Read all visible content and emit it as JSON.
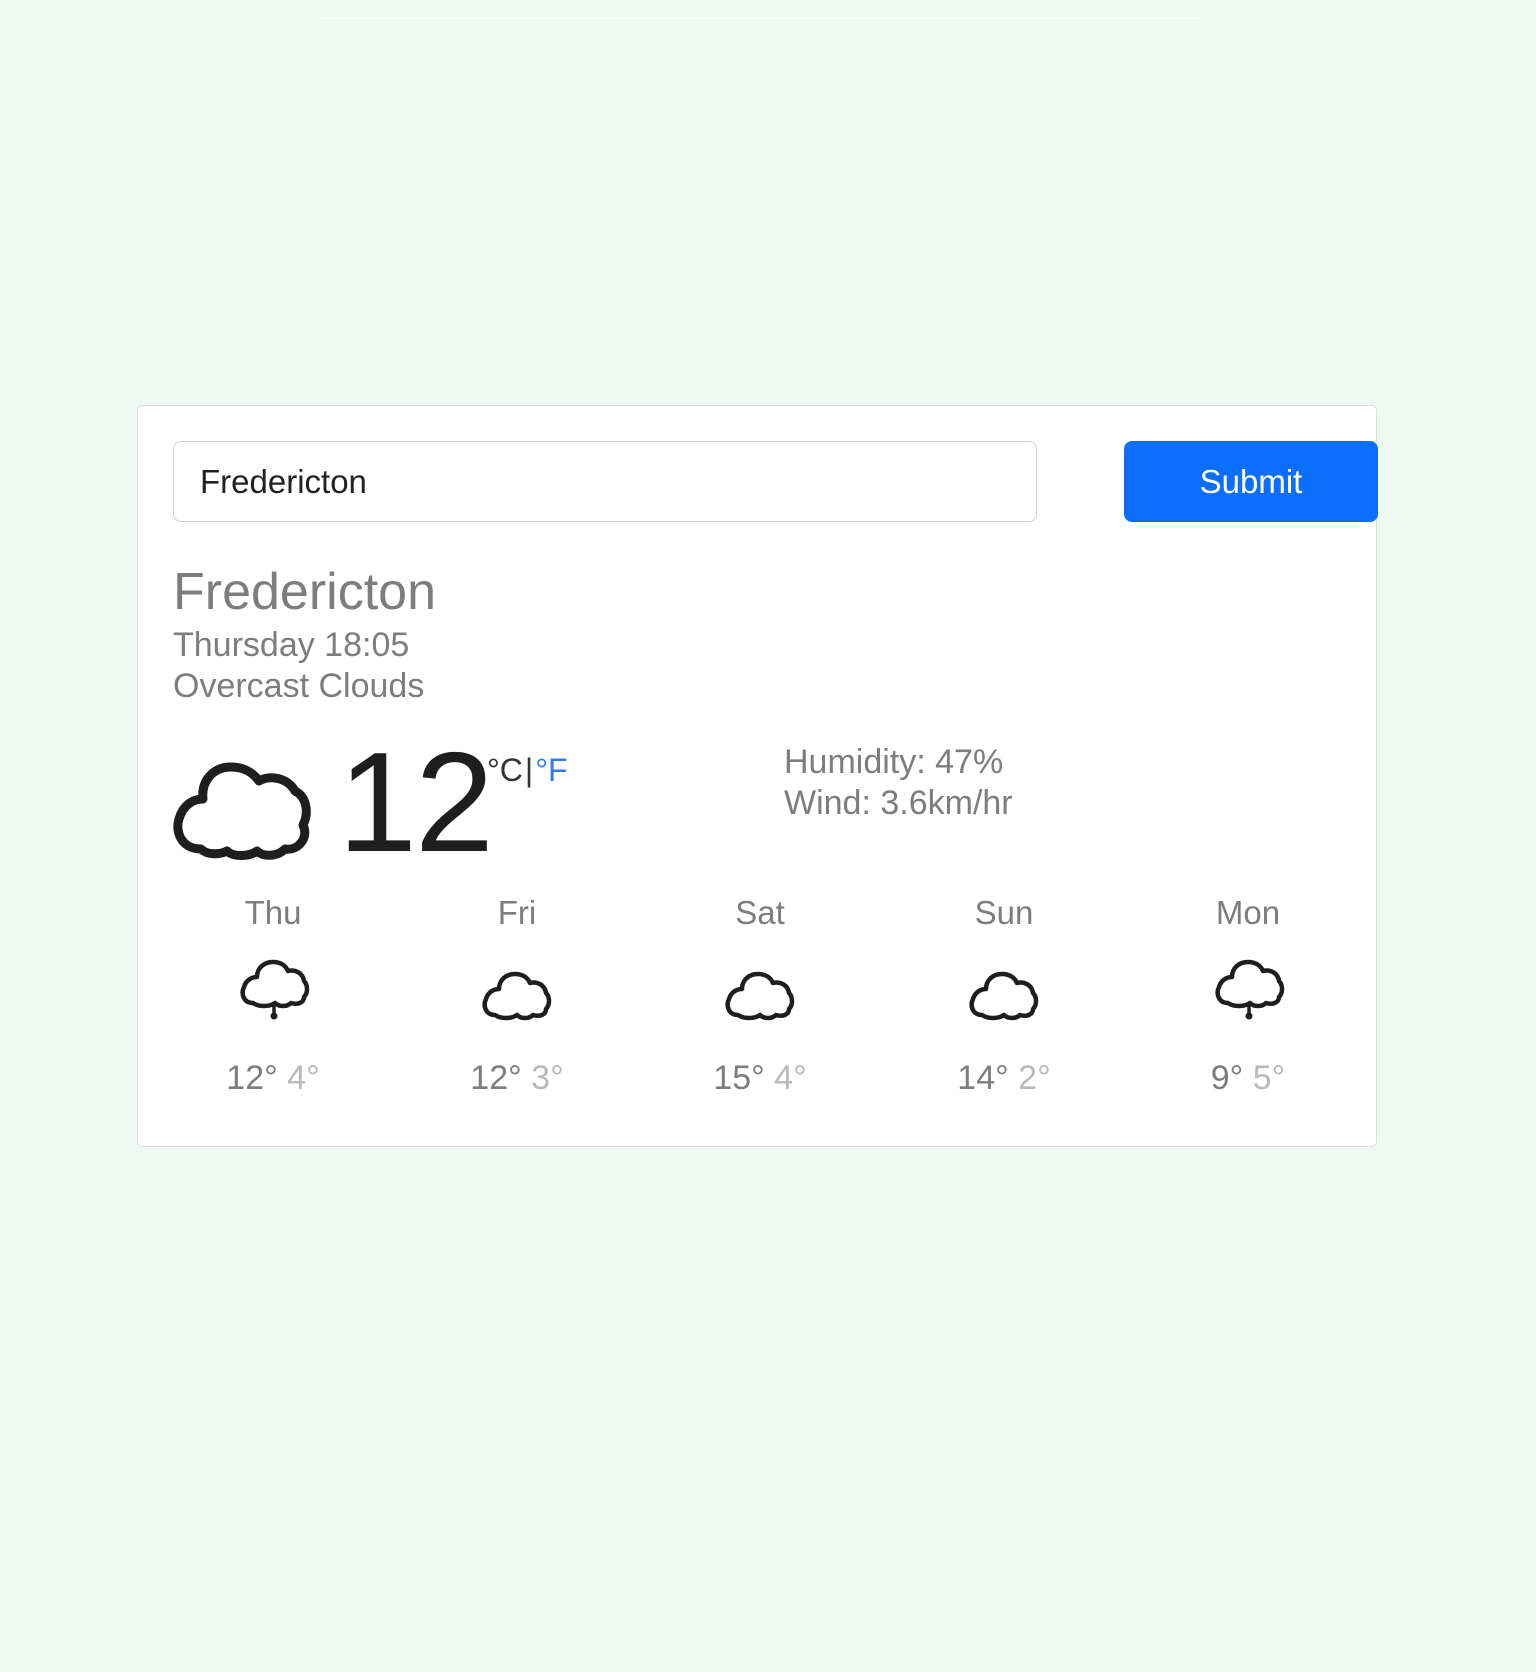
{
  "search": {
    "value": "Fredericton",
    "submit_label": "Submit"
  },
  "current": {
    "city": "Fredericton",
    "datetime": "Thursday 18:05",
    "description": "Overcast Clouds",
    "icon": "cloud-icon",
    "temperature": "12",
    "unit_celsius": "°C",
    "unit_separator": "|",
    "unit_fahrenheit": "°F",
    "humidity": "Humidity: 47%",
    "wind": "Wind: 3.6km/hr"
  },
  "forecast": [
    {
      "day": "Thu",
      "icon": "cloud-rain-icon",
      "high": "12°",
      "low": "4°"
    },
    {
      "day": "Fri",
      "icon": "cloud-icon",
      "high": "12°",
      "low": "3°"
    },
    {
      "day": "Sat",
      "icon": "cloud-icon",
      "high": "15°",
      "low": "4°"
    },
    {
      "day": "Sun",
      "icon": "cloud-icon",
      "high": "14°",
      "low": "2°"
    },
    {
      "day": "Mon",
      "icon": "cloud-rain-icon",
      "high": "9°",
      "low": "5°"
    }
  ],
  "colors": {
    "page_background": "#eff9f3",
    "accent": "#0d6efd",
    "fahrenheit_link": "#2d7cf6"
  }
}
